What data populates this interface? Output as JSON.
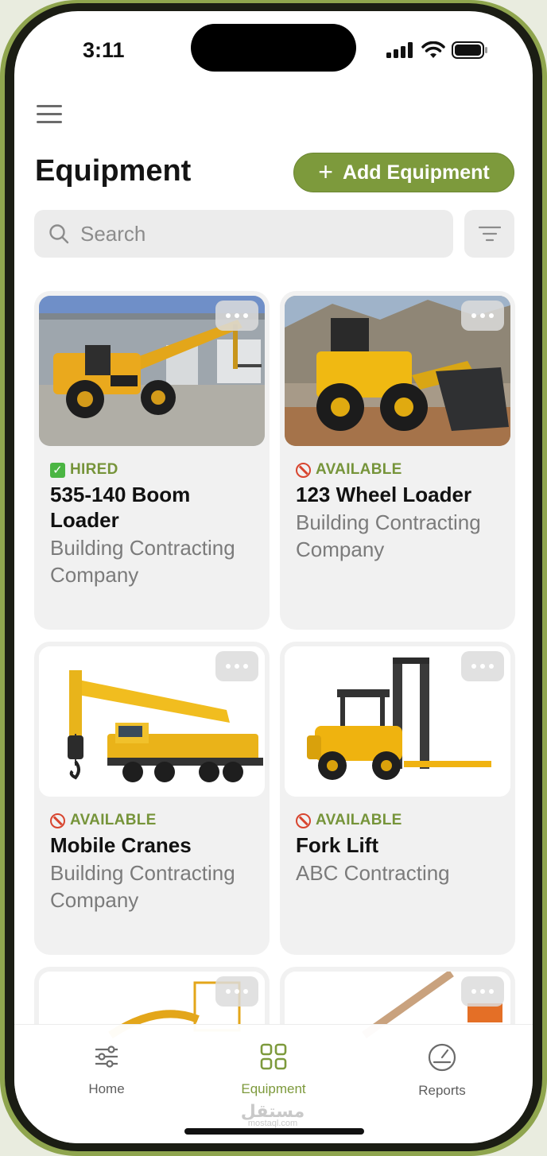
{
  "status_bar": {
    "time": "3:11"
  },
  "header": {
    "title": "Equipment",
    "add_button_label": "Add Equipment"
  },
  "search": {
    "placeholder": "Search"
  },
  "icons": {
    "menu": "hamburger-icon",
    "add": "plus-icon",
    "search": "search-icon",
    "filter": "filter-icon",
    "more": "more-dots-icon",
    "hired_status": "check-box-icon",
    "available_status": "prohibited-icon"
  },
  "colors": {
    "accent": "#7d9a3c",
    "status_text": "#76943a",
    "available_icon": "#d8452f",
    "hired_icon": "#4bb543"
  },
  "equipment": [
    {
      "status": "HIRED",
      "name": "535-140 Boom Loader",
      "company": "Building Contracting Company"
    },
    {
      "status": "AVAILABLE",
      "name": "123 Wheel Loader",
      "company": "Building Contracting Company"
    },
    {
      "status": "AVAILABLE",
      "name": "Mobile Cranes",
      "company": "Building Contracting Company"
    },
    {
      "status": "AVAILABLE",
      "name": "Fork Lift",
      "company": "ABC Contracting"
    }
  ],
  "tabs": [
    {
      "label": "Home",
      "icon": "sliders-icon"
    },
    {
      "label": "Equipment",
      "icon": "grid-icon",
      "active": true
    },
    {
      "label": "Reports",
      "icon": "gauge-icon"
    }
  ],
  "watermark": {
    "text": "مستقل",
    "sub": "mostaql.com"
  }
}
